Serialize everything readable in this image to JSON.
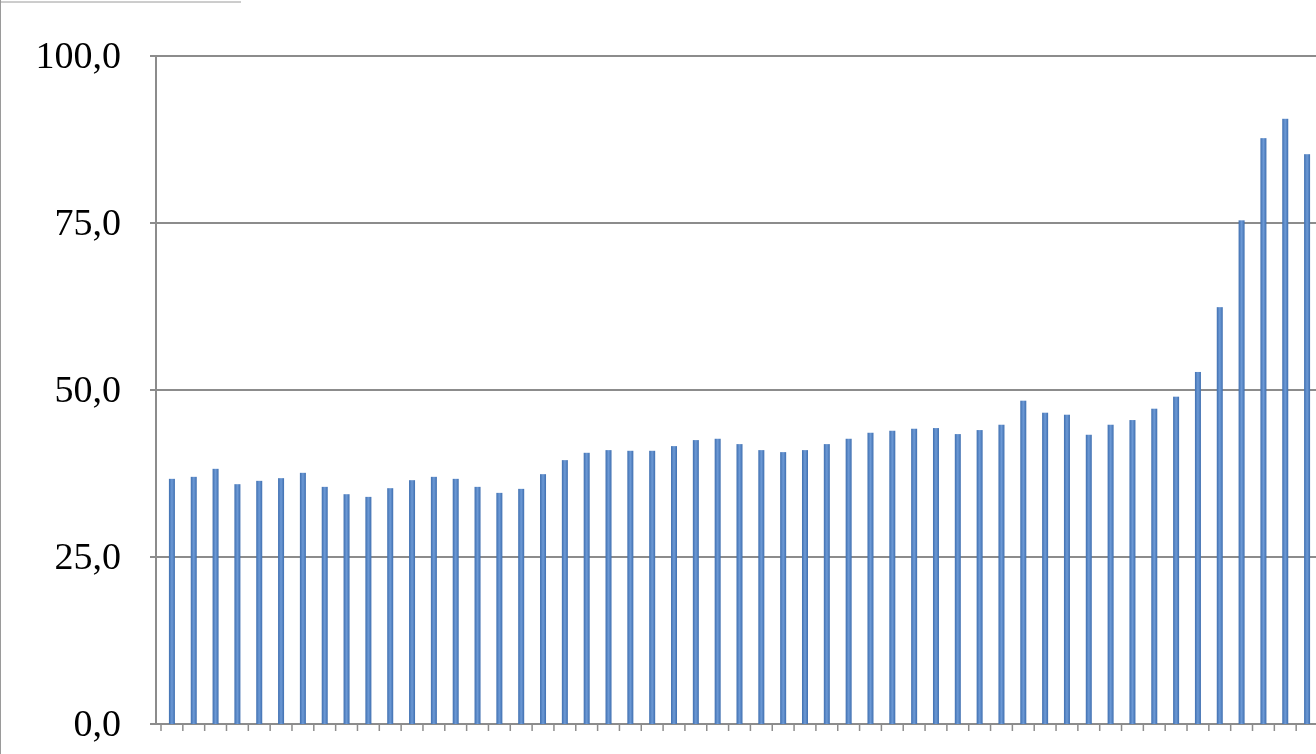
{
  "chart": {
    "chart_data": {
      "type": "bar",
      "values": [
        36.7,
        37.0,
        38.2,
        35.9,
        36.4,
        36.8,
        37.6,
        35.5,
        34.4,
        34.0,
        35.3,
        36.5,
        37.0,
        36.7,
        35.5,
        34.6,
        35.2,
        37.4,
        39.5,
        40.6,
        41.0,
        40.9,
        40.9,
        41.6,
        42.5,
        42.7,
        41.9,
        41.0,
        40.7,
        41.0,
        41.9,
        42.7,
        43.6,
        43.9,
        44.2,
        44.3,
        43.4,
        44.0,
        44.8,
        48.4,
        46.6,
        46.3,
        43.3,
        44.8,
        45.5,
        47.2,
        49.0,
        52.7,
        62.4,
        75.4,
        87.7,
        90.6,
        85.3
      ],
      "ylim": [
        0,
        100
      ],
      "grid": true,
      "yticks": [
        {
          "value": 0,
          "label": "0,0"
        },
        {
          "value": 25,
          "label": "25,0"
        },
        {
          "value": 50,
          "label": "50,0"
        },
        {
          "value": 75,
          "label": "75,0"
        },
        {
          "value": 100,
          "label": "100,0"
        }
      ]
    }
  }
}
